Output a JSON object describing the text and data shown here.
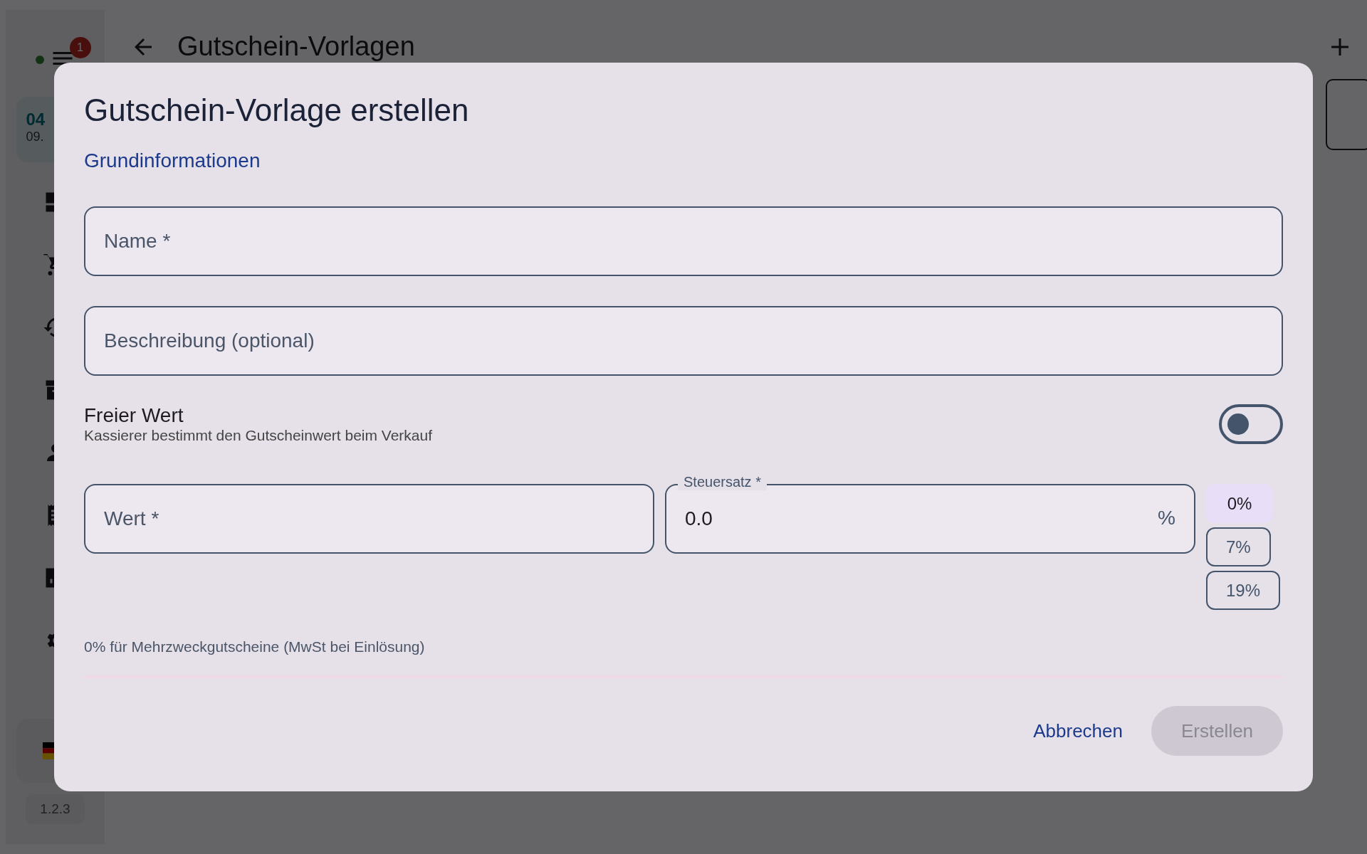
{
  "sidebar": {
    "notification_count": "1",
    "date_day": "04",
    "date_rest": "09.",
    "version": "1.2.3"
  },
  "topbar": {
    "title": "Gutschein-Vorlagen"
  },
  "dialog": {
    "title": "Gutschein-Vorlage erstellen",
    "section": "Grundinformationen",
    "name_field": {
      "placeholder": "Name *"
    },
    "description_field": {
      "placeholder": "Beschreibung (optional)"
    },
    "free_value": {
      "label": "Freier Wert",
      "description": "Kassierer bestimmt den Gutscheinwert beim Verkauf",
      "on": false
    },
    "value_field": {
      "placeholder": "Wert *"
    },
    "tax_field": {
      "label": "Steuersatz *",
      "value": "0.0",
      "suffix": "%"
    },
    "tax_presets": [
      {
        "label": "0%",
        "selected": true
      },
      {
        "label": "7%",
        "selected": false
      },
      {
        "label": "19%",
        "selected": false
      }
    ],
    "hint": "0% für Mehrzweckgutscheine (MwSt bei Einlösung)",
    "cancel": "Abbrechen",
    "create": {
      "label": "Erstellen",
      "disabled": true
    }
  }
}
